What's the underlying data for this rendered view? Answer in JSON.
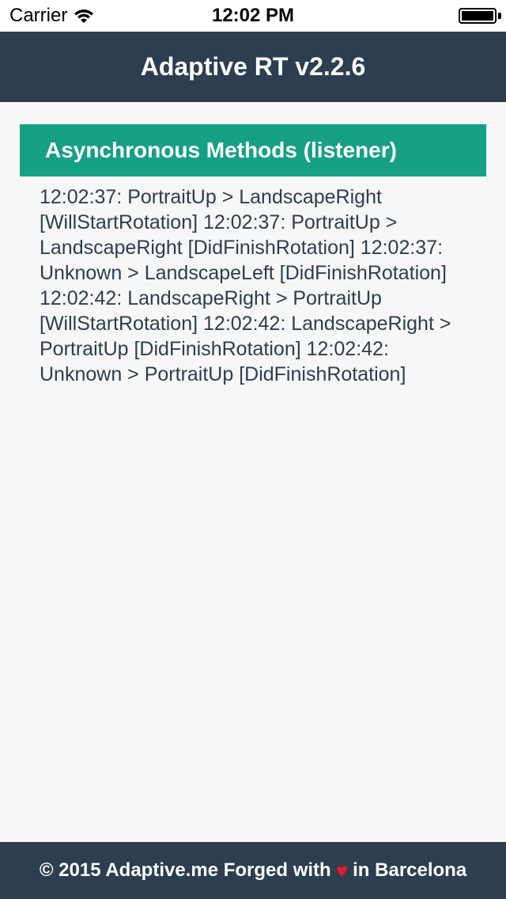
{
  "status_bar": {
    "carrier": "Carrier",
    "time": "12:02 PM",
    "wifi_icon": "wifi-icon",
    "battery_icon": "battery-full-icon"
  },
  "header": {
    "title": "Adaptive RT v2.2.6",
    "background": "#2c3e50"
  },
  "section": {
    "title": "Asynchronous Methods (listener)",
    "background": "#16a085",
    "log_text": "12:02:37: PortraitUp > LandscapeRight [WillStartRotation] 12:02:37: PortraitUp > LandscapeRight [DidFinishRotation] 12:02:37: Unknown > LandscapeLeft [DidFinishRotation] 12:02:42: LandscapeRight > PortraitUp [WillStartRotation] 12:02:42: LandscapeRight > PortraitUp [DidFinishRotation] 12:02:42: Unknown > PortraitUp [DidFinishRotation]"
  },
  "footer": {
    "prefix": "© 2015 Adaptive.me Forged with",
    "heart": "♥",
    "suffix": "in Barcelona",
    "heart_icon": "heart-icon",
    "heart_color": "#e8192c"
  }
}
